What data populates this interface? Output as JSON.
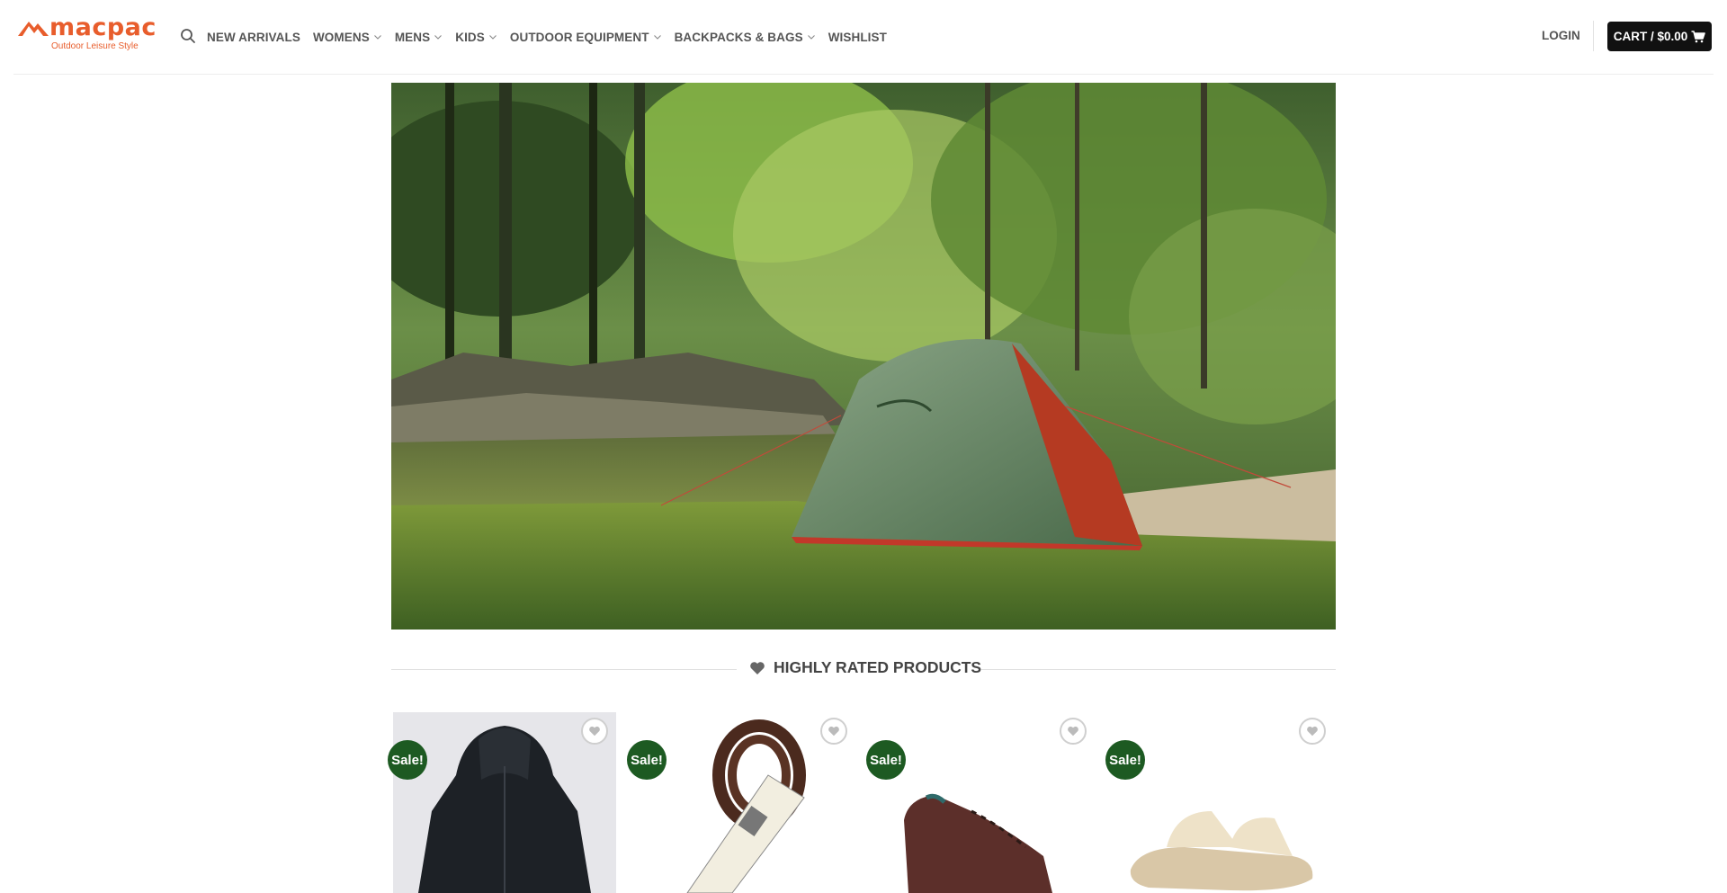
{
  "brand": {
    "name": "macpac",
    "tagline": "Outdoor Leisure Style",
    "color": "#e85d2c"
  },
  "nav": {
    "search_icon": "search-icon",
    "items": [
      {
        "label": "NEW ARRIVALS",
        "has_dropdown": false
      },
      {
        "label": "WOMENS",
        "has_dropdown": true
      },
      {
        "label": "MENS",
        "has_dropdown": true
      },
      {
        "label": "KIDS",
        "has_dropdown": true
      },
      {
        "label": "OUTDOOR EQUIPMENT",
        "has_dropdown": true
      },
      {
        "label": "BACKPACKS & BAGS",
        "has_dropdown": true
      },
      {
        "label": "WISHLIST",
        "has_dropdown": false
      }
    ],
    "login": "LOGIN",
    "cart": "CART / $0.00",
    "cart_icon": "shopping-cart-icon"
  },
  "hero": {
    "image": "green tent pitched on grass beside a river under trees"
  },
  "section": {
    "title": "HIGHLY RATED PRODUCTS",
    "icon": "heart-icon"
  },
  "products": [
    {
      "badge": "Sale!",
      "image": "black hooded jacket"
    },
    {
      "badge": "Sale!",
      "image": "brown boot laces"
    },
    {
      "badge": "Sale!",
      "image": "brown hiking shoe"
    },
    {
      "badge": "Sale!",
      "image": "cream slide sandal"
    }
  ],
  "colors": {
    "sale_badge": "#1d5a22",
    "cart_button": "#111111",
    "nav_text": "#555555"
  }
}
